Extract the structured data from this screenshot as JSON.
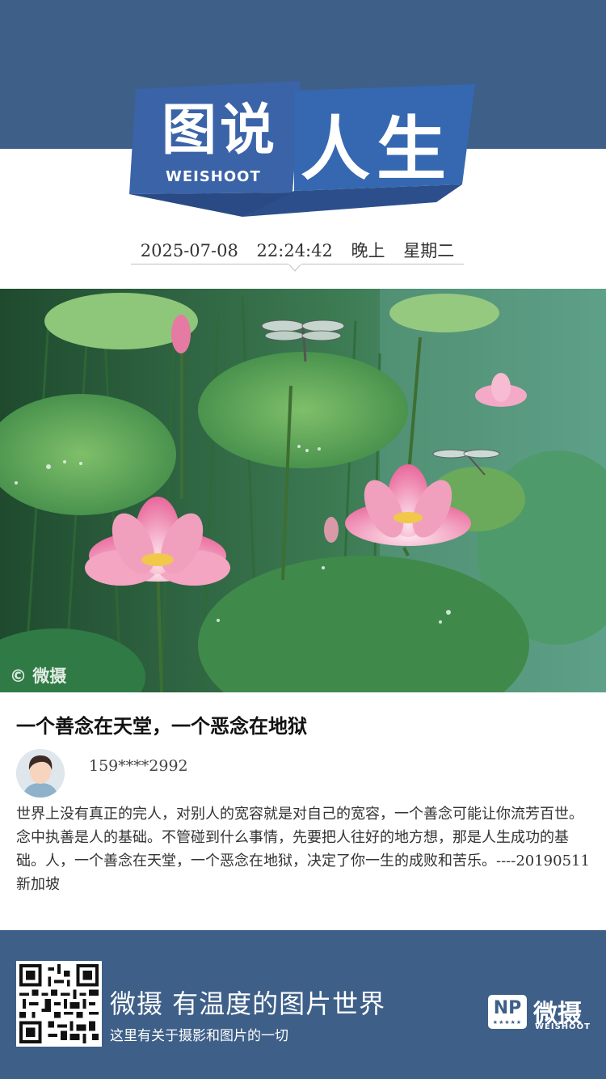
{
  "header": {
    "logo_left": "图说",
    "logo_sub": "WEISHOOT",
    "logo_right": "人生",
    "date": "2025-07-08",
    "time": "22:24:42",
    "period": "晚上",
    "weekday": "星期二",
    "colors": {
      "band": "#3e5f88",
      "logo_blue": "#3a63a8",
      "logo_dark": "#2c4f8c"
    }
  },
  "photo": {
    "watermark": "© 微摄",
    "subject": "lotus-pond-image"
  },
  "post": {
    "title": "一个善念在天堂，一个恶念在地狱",
    "username": "159****2992",
    "body": "世界上没有真正的完人，对别人的宽容就是对自己的宽容，一个善念可能让你流芳百世。念中执善是人的基础。不管碰到什么事情，先要把人往好的地方想，那是人生成功的基础。人，一个善念在天堂，一个恶念在地狱，决定了你一生的成败和苦乐。----20190511 新加坡"
  },
  "footer": {
    "slogan": "微摄  有温度的图片世界",
    "tagline": "这里有关于摄影和图片的一切",
    "badge": "NP",
    "badge_stars": "★★★★★",
    "brand_cn": "微摄",
    "brand_en": "WEISHOOT"
  }
}
